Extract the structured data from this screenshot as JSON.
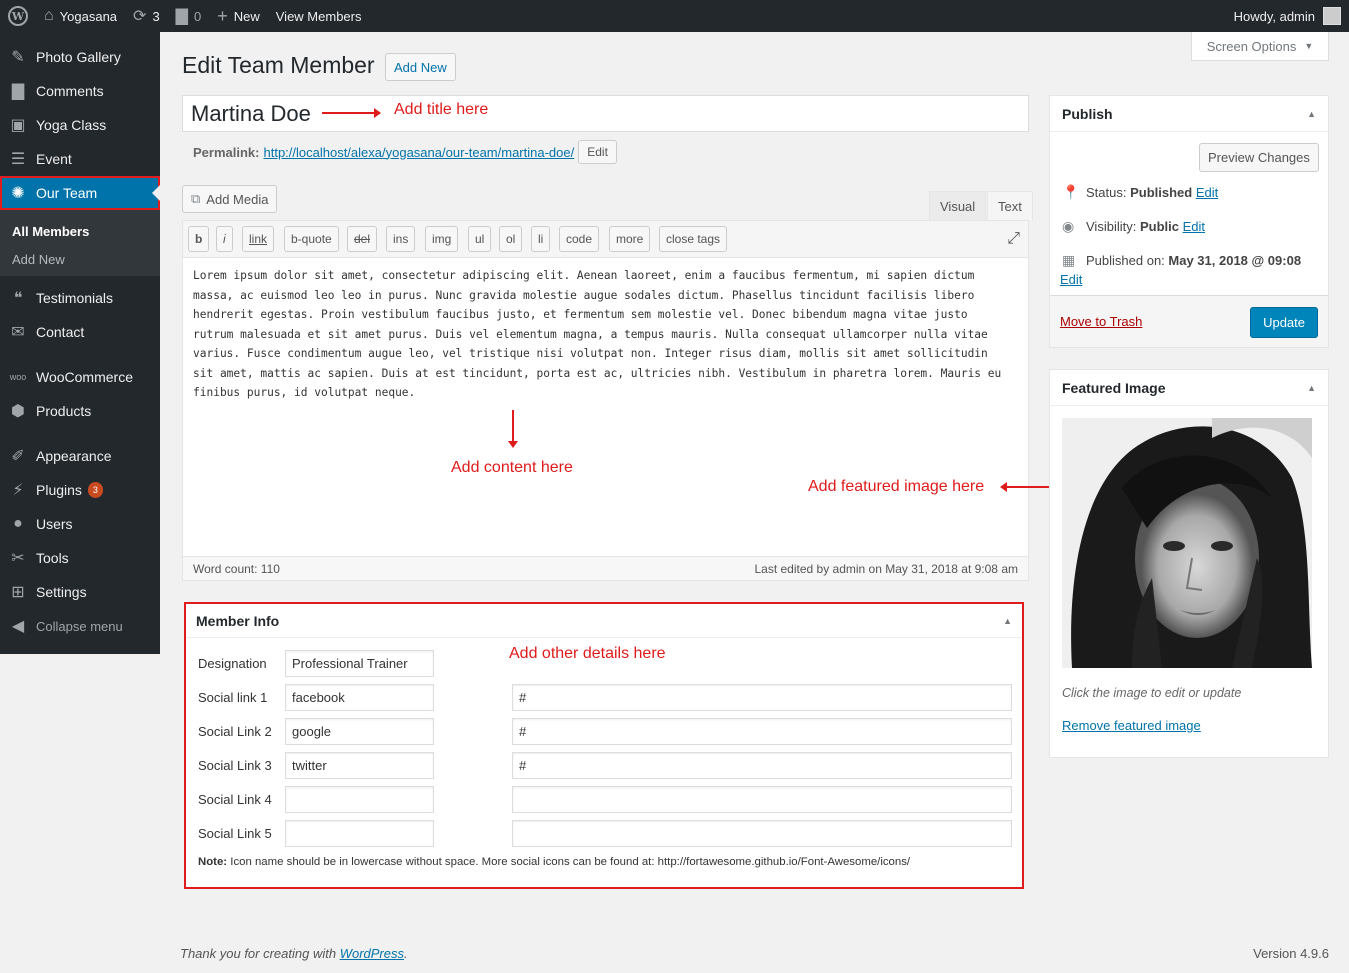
{
  "adminbar": {
    "site_name": "Yogasana",
    "updates_count": "3",
    "comments_count": "0",
    "new_label": "New",
    "view_label": "View Members",
    "howdy": "Howdy, admin"
  },
  "sidebar": {
    "items": [
      {
        "label": "Photo Gallery",
        "icon": "pin-icon"
      },
      {
        "label": "Comments",
        "icon": "comment-icon"
      },
      {
        "label": "Yoga Class",
        "icon": "image-icon"
      },
      {
        "label": "Event",
        "icon": "list-icon"
      },
      {
        "label": "Our Team",
        "icon": "team-icon"
      },
      {
        "label": "Testimonials",
        "icon": "quote-icon"
      },
      {
        "label": "Contact",
        "icon": "mail-icon"
      },
      {
        "label": "WooCommerce",
        "icon": "woo-icon"
      },
      {
        "label": "Products",
        "icon": "box-icon"
      },
      {
        "label": "Appearance",
        "icon": "brush-icon"
      },
      {
        "label": "Plugins",
        "icon": "plug-icon",
        "badge": "3"
      },
      {
        "label": "Users",
        "icon": "user-icon"
      },
      {
        "label": "Tools",
        "icon": "wrench-icon"
      },
      {
        "label": "Settings",
        "icon": "sliders-icon"
      },
      {
        "label": "Collapse menu",
        "icon": "collapse-icon"
      }
    ],
    "submenu": {
      "all_members": "All Members",
      "add_new": "Add New"
    }
  },
  "screen_options": "Screen Options",
  "page": {
    "title": "Edit Team Member",
    "add_new": "Add New",
    "post_title": "Martina Doe",
    "permalink_label": "Permalink:",
    "permalink_url": "http://localhost/alexa/yogasana/our-team/martina-doe/",
    "permalink_edit": "Edit"
  },
  "annotations": {
    "title": "Add title here",
    "content": "Add content here",
    "featured": "Add featured image here",
    "details": "Add other details here"
  },
  "editor": {
    "add_media": "Add Media",
    "tab_visual": "Visual",
    "tab_text": "Text",
    "quicktags": [
      "b",
      "i",
      "link",
      "b-quote",
      "del",
      "ins",
      "img",
      "ul",
      "ol",
      "li",
      "code",
      "more",
      "close tags"
    ],
    "content": "Lorem ipsum dolor sit amet, consectetur adipiscing elit. Aenean laoreet, enim a faucibus fermentum, mi sapien dictum massa, ac euismod leo leo in purus. Nunc gravida molestie augue sodales dictum. Phasellus tincidunt facilisis libero hendrerit egestas. Proin vestibulum faucibus justo, et fermentum sem molestie vel. Donec bibendum magna vitae justo rutrum malesuada et sit amet purus. Duis vel elementum magna, a tempus mauris. Nulla consequat ullamcorper nulla vitae varius. Fusce condimentum augue leo, vel tristique nisi volutpat non. Integer risus diam, mollis sit amet sollicitudin sit amet, mattis ac sapien. Duis at est tincidunt, porta est ac, ultricies nibh. Vestibulum in pharetra lorem. Mauris eu finibus purus, id volutpat neque.",
    "word_count": "Word count: 110",
    "last_edited": "Last edited by admin on May 31, 2018 at 9:08 am"
  },
  "member_info": {
    "title": "Member Info",
    "designation_label": "Designation",
    "designation_value": "Professional Trainer",
    "rows": [
      {
        "label": "Social link 1",
        "name": "facebook",
        "link": "#"
      },
      {
        "label": "Social Link 2",
        "name": "google",
        "link": "#"
      },
      {
        "label": "Social Link 3",
        "name": "twitter",
        "link": "#"
      },
      {
        "label": "Social Link 4",
        "name": "",
        "link": ""
      },
      {
        "label": "Social Link 5",
        "name": "",
        "link": ""
      }
    ],
    "note_prefix": "Note:",
    "note_text": "Icon name should be in lowercase without space. More social icons can be found at: http://fortawesome.github.io/Font-Awesome/icons/"
  },
  "publish": {
    "title": "Publish",
    "preview": "Preview Changes",
    "status_label": "Status:",
    "status_value": "Published",
    "visibility_label": "Visibility:",
    "visibility_value": "Public",
    "published_label": "Published on:",
    "published_value": "May 31, 2018 @ 09:08",
    "edit": "Edit",
    "trash": "Move to Trash",
    "update": "Update"
  },
  "featured_image": {
    "title": "Featured Image",
    "hint": "Click the image to edit or update",
    "remove": "Remove featured image"
  },
  "footer": {
    "thanks_prefix": "Thank you for creating with ",
    "thanks_link": "WordPress",
    "thanks_suffix": ".",
    "version": "Version 4.9.6"
  },
  "colors": {
    "accent": "#0073aa",
    "annotation": "#e01b1b",
    "sidebar": "#23282d"
  }
}
